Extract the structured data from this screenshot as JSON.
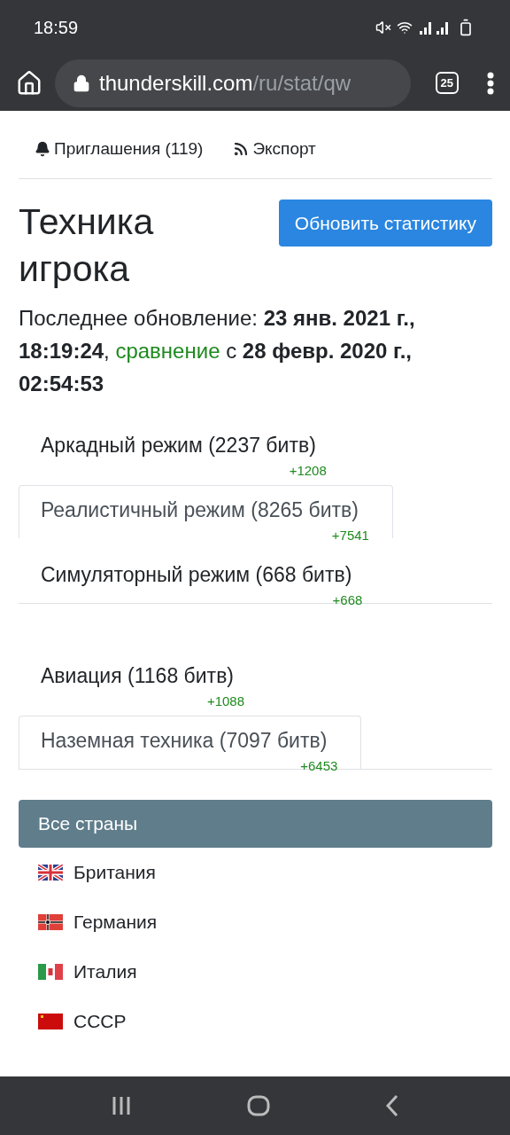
{
  "status_bar": {
    "time": "18:59"
  },
  "browser": {
    "url_host": "thunderskill.com",
    "url_path": "/ru/stat/qw",
    "tab_count": "25"
  },
  "nav_links": [
    {
      "label": "Приглашения (119)"
    },
    {
      "label": "Экспорт"
    }
  ],
  "title": "Техника игрока",
  "refresh_button": "Обновить статистику",
  "update_info": {
    "prefix": "Последнее обновление: ",
    "date": "23 янв. 2021 г., 18:19:24",
    "sep": ", ",
    "link": "сравнение",
    "mid": " с ",
    "compare_date": "28 февр. 2020 г., 02:54:53"
  },
  "mode_tabs": [
    {
      "label": "Аркадный режим (2237 битв)",
      "delta": "+1208",
      "selected": false
    },
    {
      "label": "Реалистичный режим (8265 битв)",
      "delta": "+7541",
      "selected": true
    },
    {
      "label": "Симуляторный режим (668 битв)",
      "delta": "+668",
      "selected": false
    }
  ],
  "type_tabs": [
    {
      "label": "Авиация (1168 битв)",
      "delta": "+1088",
      "selected": false
    },
    {
      "label": "Наземная техника (7097 битв)",
      "delta": "+6453",
      "selected": true
    }
  ],
  "countries": {
    "header": "Все страны",
    "items": [
      {
        "name": "Британия"
      },
      {
        "name": "Германия"
      },
      {
        "name": "Италия"
      },
      {
        "name": "СССР"
      }
    ]
  }
}
